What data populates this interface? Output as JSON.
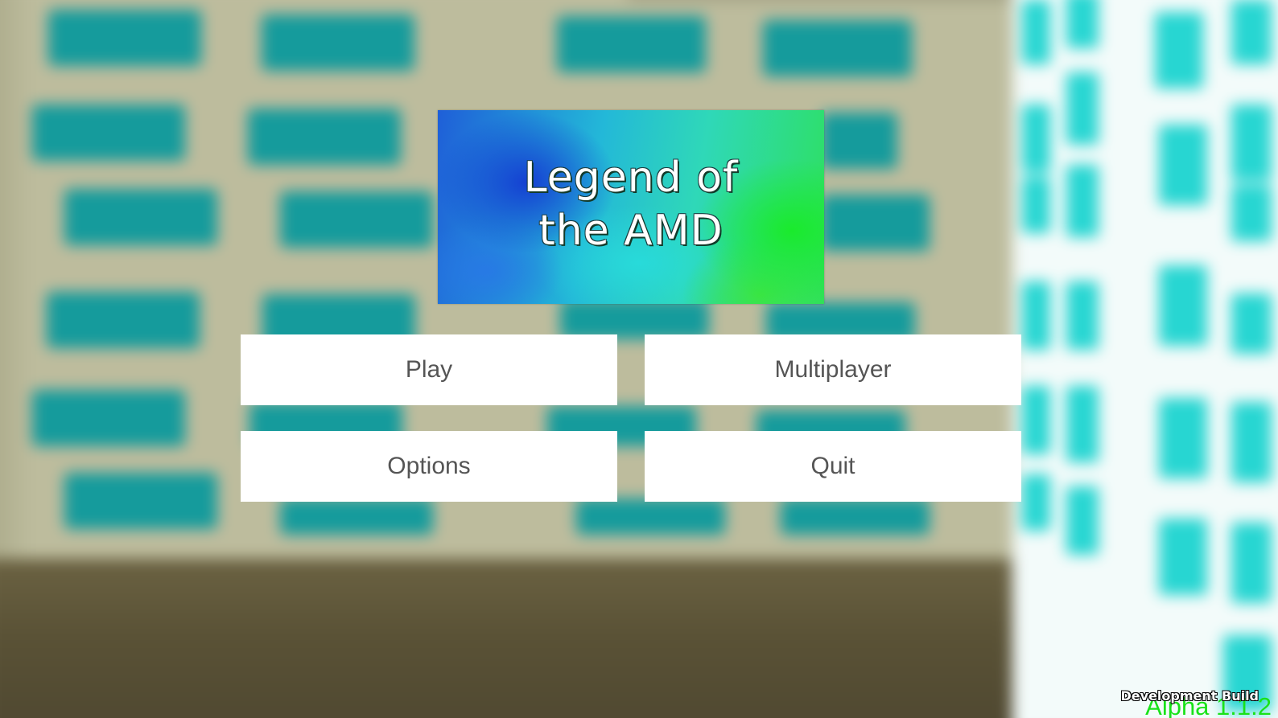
{
  "title": {
    "logo_text": "Legend of\nthe AMD",
    "logo_alt": "Legend of the AMD"
  },
  "menu": {
    "play_label": "Play",
    "multiplayer_label": "Multiplayer",
    "options_label": "Options",
    "quit_label": "Quit"
  },
  "footer": {
    "version": "Alpha 1.1.2",
    "build_label": "Development Build"
  },
  "colors": {
    "button_bg": "#ffffff",
    "button_text": "#555555",
    "version_text": "#19e219",
    "tile_teal": "#159b9c",
    "tile_cyan": "#27d6d2"
  }
}
